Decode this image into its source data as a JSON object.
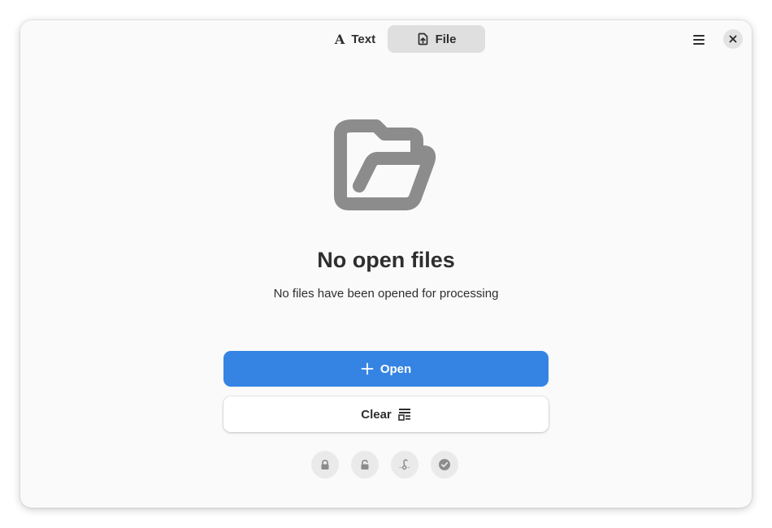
{
  "header": {
    "tabs": [
      {
        "label": "Text",
        "icon": "text-icon",
        "glyph": "A",
        "active": false
      },
      {
        "label": "File",
        "icon": "file-upload-icon",
        "active": true
      }
    ],
    "menu_icon": "hamburger-menu-icon",
    "close_icon": "close-icon"
  },
  "empty_state": {
    "icon": "folder-open-icon",
    "title": "No open files",
    "description": "No files have been opened for processing"
  },
  "actions": {
    "open_label": "Open",
    "open_icon": "plus-icon",
    "clear_label": "Clear",
    "clear_icon": "clear-list-icon"
  },
  "status_icons": [
    "lock-icon",
    "unlock-icon",
    "key-icon",
    "verified-check-icon"
  ],
  "colors": {
    "accent": "#3584e4",
    "window_bg": "#fafafa",
    "icon_gray": "#8c8c8c",
    "text": "#2e2e2e"
  }
}
